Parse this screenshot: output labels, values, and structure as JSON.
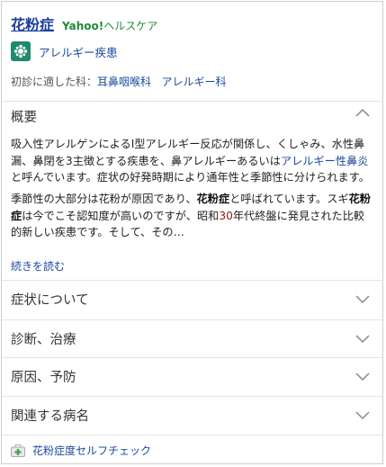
{
  "header": {
    "title": "花粉症",
    "source_brand": "Yahoo!",
    "source_suffix": "ヘルスケア"
  },
  "category": {
    "label": "アレルギー疾患"
  },
  "department": {
    "prefix": "初診に適した科：",
    "items": [
      "耳鼻咽喉科",
      "アレルギー科"
    ]
  },
  "overview": {
    "heading": "概要",
    "p1_a": "吸入性アレルゲンによるⅠ型アレルギー反応が関係し、くしゃみ、水性鼻漏、鼻閉を3主徴とする疾患を、鼻アレルギーあるいは",
    "p1_link": "アレルギー性鼻炎",
    "p1_b": "と呼んでいます。症状の好発時期により通年性と季節性に分けられます。",
    "p2_a": "季節性の大部分は花粉が原因であり、",
    "p2_bold1": "花粉症",
    "p2_b": "と呼ばれています。スギ",
    "p2_bold2": "花粉症",
    "p2_c": "は今でこそ認知度が高いのですが、昭和",
    "p2_num": "30",
    "p2_d": "年代終盤に発見された比較的新しい疾患です。そして、その…",
    "read_more": "続きを読む"
  },
  "sections": [
    {
      "label": "症状について"
    },
    {
      "label": "診断、治療"
    },
    {
      "label": "原因、予防"
    },
    {
      "label": "関連する病名"
    }
  ],
  "footer": {
    "label": "花粉症度セルフチェック"
  },
  "colors": {
    "title": "#1a3f9e",
    "brand": "#1e8a3a",
    "link": "#1a4a9e",
    "icon_bg": "#1f8a6f"
  }
}
